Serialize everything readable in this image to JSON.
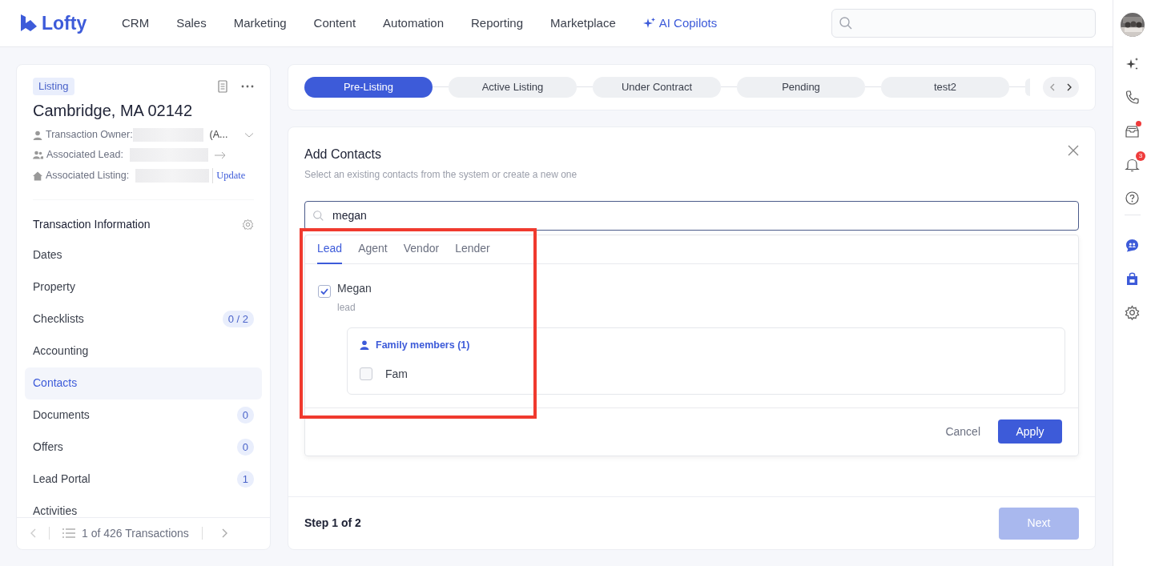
{
  "brand": "Lofty",
  "nav": [
    {
      "label": "CRM",
      "kind": "plain"
    },
    {
      "label": "Sales",
      "kind": "plain"
    },
    {
      "label": "Marketing",
      "kind": "plain"
    },
    {
      "label": "Content",
      "kind": "plain"
    },
    {
      "label": "Automation",
      "kind": "plain"
    },
    {
      "label": "Reporting",
      "kind": "plain"
    },
    {
      "label": "Marketplace",
      "kind": "plain"
    },
    {
      "label": "AI Copilots",
      "kind": "ai"
    }
  ],
  "listing": {
    "tag": "Listing",
    "title": "Cambridge, MA 02142",
    "owner_label": "Transaction Owner:",
    "owner_suffix": "(A...",
    "lead_label": "Associated Lead:",
    "listing_label": "Associated Listing:",
    "update": "Update"
  },
  "section": {
    "title": "Transaction Information",
    "items": [
      {
        "label": "Dates",
        "selected": false
      },
      {
        "label": "Property",
        "selected": false
      },
      {
        "label": "Checklists",
        "selected": false,
        "count": "0 / 2"
      },
      {
        "label": "Accounting",
        "selected": false
      },
      {
        "label": "Contacts",
        "selected": true
      },
      {
        "label": "Documents",
        "selected": false,
        "count": "0"
      },
      {
        "label": "Offers",
        "selected": false,
        "count": "0"
      },
      {
        "label": "Lead Portal",
        "selected": false,
        "count": "1"
      },
      {
        "label": "Activities",
        "selected": false
      }
    ]
  },
  "pager": {
    "text": "1 of 426 Transactions"
  },
  "stages": [
    {
      "label": "Pre-Listing",
      "selected": true
    },
    {
      "label": "Active Listing",
      "selected": false
    },
    {
      "label": "Under Contract",
      "selected": false
    },
    {
      "label": "Pending",
      "selected": false
    },
    {
      "label": "test2",
      "selected": false
    }
  ],
  "dialog": {
    "title": "Add Contacts",
    "subtitle": "Select an existing contacts from the system or create a new one",
    "search_value": "megan",
    "tabs": [
      {
        "label": "Lead",
        "selected": true
      },
      {
        "label": "Agent",
        "selected": false
      },
      {
        "label": "Vendor",
        "selected": false
      },
      {
        "label": "Lender",
        "selected": false
      }
    ],
    "results": [
      {
        "name": "Megan",
        "role": "lead",
        "checked": true,
        "family_title": "Family members (1)",
        "members": [
          {
            "name": "Fam",
            "checked": false
          }
        ]
      }
    ],
    "cancel": "Cancel",
    "apply": "Apply"
  },
  "footer": {
    "step": "Step 1 of 2",
    "next": "Next",
    "next_disabled": true
  },
  "rail": [
    {
      "kind": "avatar"
    },
    {
      "kind": "sparkle"
    },
    {
      "kind": "phone"
    },
    {
      "kind": "inbox",
      "dot": true
    },
    {
      "kind": "bell",
      "badge": "3"
    },
    {
      "kind": "help"
    },
    {
      "kind": "divider"
    },
    {
      "kind": "chat"
    },
    {
      "kind": "store"
    },
    {
      "kind": "settings"
    }
  ]
}
